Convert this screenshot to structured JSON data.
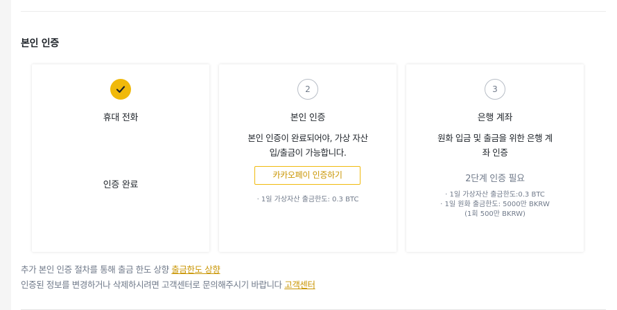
{
  "section": {
    "title": "본인 인증"
  },
  "cards": [
    {
      "step": "",
      "step_icon": "checkmark-icon",
      "title": "휴대 전화",
      "status": "인증 완료"
    },
    {
      "step": "2",
      "title": "본인 인증",
      "description": "본인 인증이 완료되어야, 가상 자산 입/출금이 가능합니다.",
      "button": "카카오페이 인증하기",
      "limits": [
        "· 1일 가상자산 출금한도: 0.3 BTC"
      ]
    },
    {
      "step": "3",
      "title": "은행 계좌",
      "description": "원화 입금 및 출금을 위한 은행 계좌 인증",
      "status": "2단계 인증 필요",
      "limits": [
        "· 1일 가상자산 출금한도:0.3 BTC",
        "· 1일 원화 출금한도: 5000만 BKRW",
        "(1회 500만 BKRW)"
      ]
    }
  ],
  "footer": {
    "line1_text": "추가 본인 인증 절차를 통해 출금 한도 상향 ",
    "line1_link": "출금한도 상향",
    "line2_text": "인증된 정보를 변경하거나 삭제하시려면 고객센터로 문의해주시기 바랍니다 ",
    "line2_link": "고객센터"
  },
  "colors": {
    "accent": "#f0b90b",
    "link": "#c99400",
    "muted": "#707a8a"
  }
}
